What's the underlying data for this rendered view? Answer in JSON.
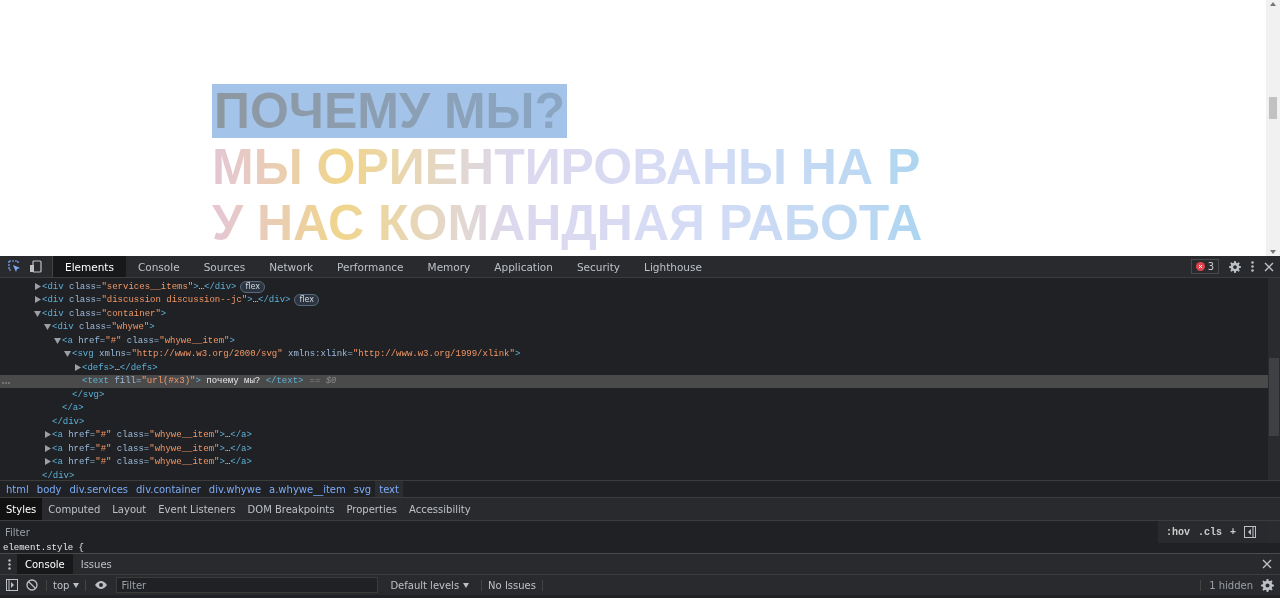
{
  "page": {
    "headings": [
      {
        "text": "ПОЧЕМУ МЫ?",
        "inspected": true
      },
      {
        "text": "МЫ ОРИЕНТИРОВАНЫ НА Р",
        "inspected": false
      },
      {
        "text": "У НАС КОМАНДНАЯ РАБОТА",
        "inspected": false
      }
    ]
  },
  "devtools": {
    "tabs": [
      {
        "label": "Elements",
        "selected": true
      },
      {
        "label": "Console",
        "selected": false
      },
      {
        "label": "Sources",
        "selected": false
      },
      {
        "label": "Network",
        "selected": false
      },
      {
        "label": "Performance",
        "selected": false
      },
      {
        "label": "Memory",
        "selected": false
      },
      {
        "label": "Application",
        "selected": false
      },
      {
        "label": "Security",
        "selected": false
      },
      {
        "label": "Lighthouse",
        "selected": false
      }
    ],
    "error_count": "3",
    "dom_tree": [
      {
        "markup": "<div class=\"services__items\">…</div>",
        "badge": "flex",
        "expanded": false,
        "selected": false
      },
      {
        "markup": "<div class=\"discussion discussion--jc\">…</div>",
        "badge": "flex",
        "expanded": false,
        "selected": false
      },
      {
        "markup": "<div class=\"container\">",
        "expanded": true,
        "selected": false,
        "close": "</div>",
        "children": [
          {
            "markup": "<div class=\"whywe\">",
            "expanded": true,
            "selected": false,
            "close": "</div>",
            "children": [
              {
                "markup": "<a href=\"#\" class=\"whywe__item\">",
                "expanded": true,
                "selected": false,
                "close": "</a>",
                "children": [
                  {
                    "markup": "<svg xmlns=\"http://www.w3.org/2000/svg\" xmlns:xlink=\"http://www.w3.org/1999/xlink\">",
                    "expanded": true,
                    "selected": false,
                    "close": "</svg>",
                    "children": [
                      {
                        "markup": "<defs>…</defs>",
                        "expanded": false,
                        "selected": false
                      },
                      {
                        "markup": "<text fill=\"url(#x3)\"> почему мы? </text>",
                        "suffix": "== $0",
                        "selected": true
                      }
                    ]
                  }
                ]
              }
            ]
          },
          {
            "markup": "<a href=\"#\" class=\"whywe__item\">…</a>",
            "expanded": false,
            "selected": false
          },
          {
            "markup": "<a href=\"#\" class=\"whywe__item\">…</a>",
            "expanded": false,
            "selected": false
          },
          {
            "markup": "<a href=\"#\" class=\"whywe__item\">…</a>",
            "expanded": false,
            "selected": false
          }
        ]
      }
    ],
    "breadcrumbs": [
      {
        "label": "html",
        "selected": false
      },
      {
        "label": "body",
        "selected": false
      },
      {
        "label": "div.services",
        "selected": false
      },
      {
        "label": "div.container",
        "selected": false
      },
      {
        "label": "div.whywe",
        "selected": false
      },
      {
        "label": "a.whywe__item",
        "selected": false
      },
      {
        "label": "svg",
        "selected": false
      },
      {
        "label": "text",
        "selected": true
      }
    ],
    "style_tabs": [
      {
        "label": "Styles",
        "selected": true
      },
      {
        "label": "Computed",
        "selected": false
      },
      {
        "label": "Layout",
        "selected": false
      },
      {
        "label": "Event Listeners",
        "selected": false
      },
      {
        "label": "DOM Breakpoints",
        "selected": false
      },
      {
        "label": "Properties",
        "selected": false
      },
      {
        "label": "Accessibility",
        "selected": false
      }
    ],
    "styles_filter": {
      "placeholder": "Filter"
    },
    "style_buttons": [
      ":hov",
      ".cls",
      "+"
    ],
    "style_rule": "element.style {",
    "drawer_tabs": [
      {
        "label": "Console",
        "selected": true
      },
      {
        "label": "Issues",
        "selected": false
      }
    ],
    "console": {
      "context": "top",
      "filter": {
        "placeholder": "Filter"
      },
      "levels": "Default levels",
      "issues": "No Issues",
      "hidden": "1 hidden"
    }
  }
}
